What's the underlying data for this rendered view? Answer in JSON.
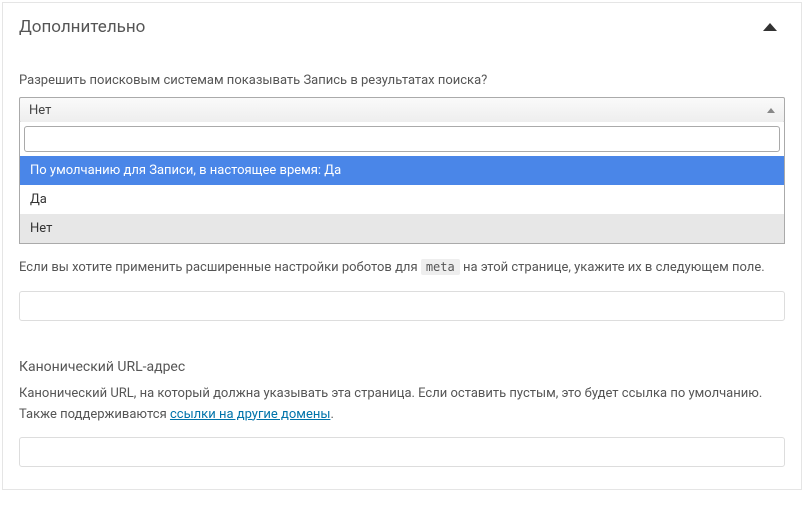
{
  "panel": {
    "title": "Дополнительно"
  },
  "search_engines": {
    "label": "Разрешить поисковым системам показывать Запись в результатах поиска?",
    "selected": "Нет",
    "options": {
      "default": "По умолчанию для Записи, в настоящее время: Да",
      "yes": "Да",
      "no": "Нет"
    }
  },
  "robots": {
    "help_before": "Если вы хотите применить расширенные настройки роботов для ",
    "code": "meta",
    "help_after": " на этой странице, укажите их в следующем поле."
  },
  "canonical": {
    "title": "Канонический URL-адрес",
    "help_before": "Канонический URL, на который должна указывать эта страница. Если оставить пустым, это будет ссылка по умолчанию. Также поддерживаются ",
    "link_text": "ссылки на другие домены",
    "help_after": "."
  }
}
